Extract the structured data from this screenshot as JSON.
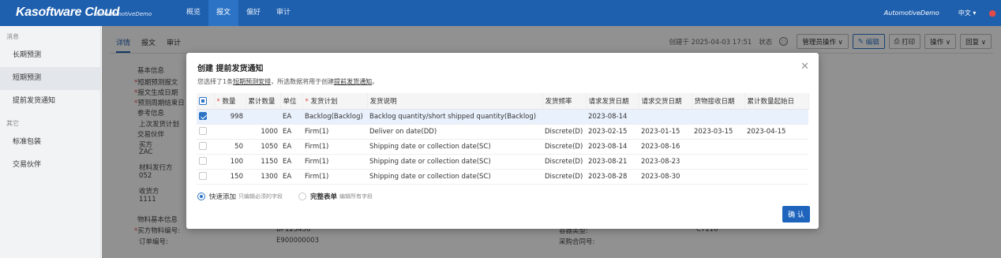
{
  "topbar": {
    "brand": "Kasoftware Cloud",
    "brand_sub": "for AutomotiveDemo",
    "nav": [
      "概览",
      "报文",
      "偏好",
      "审计"
    ],
    "active_nav": 1,
    "tenant": "AutomotiveDemo",
    "language": "中文 ▾"
  },
  "sidebar": {
    "group1": "消息",
    "items1": [
      "长期预测",
      "短期预测",
      "提前发货通知"
    ],
    "active_item": 1,
    "group2": "其它",
    "items2": [
      "标准包装",
      "交易伙伴"
    ]
  },
  "main": {
    "tabs": [
      "详情",
      "报文",
      "审计"
    ],
    "created": "创建于 2025-04-03 17:51",
    "status_label": "状态",
    "buttons": {
      "admin": "管理员操作 ∨",
      "edit": "编辑",
      "print": "打印",
      "ops": "操作 ∨",
      "reply": "回复 ∨"
    }
  },
  "background_form": {
    "basic_info": "基本信息",
    "f1": "短期预测报文",
    "f2": "报文生成日期",
    "f3": "预测周期结束日",
    "ref_info": "参考信息",
    "last_plan": "上次发货计划",
    "partners": "交易伙伴",
    "buyer": "买方",
    "buyer_val": "ZAC",
    "mat_issuer": "材料发行方",
    "mat_issuer_val": "052",
    "receiver": "收货方",
    "receiver_val": "1111",
    "material_info": "物料基本信息",
    "buyer_part_no": "买方物料编号:",
    "buyer_part_val": "BP123456",
    "container_type": "容器类型:",
    "container_val": "CT116",
    "order_no": "订单编号:",
    "order_val": "E900000003",
    "purchase_no": "采购合同号:"
  },
  "dialog": {
    "title": "创建 提前发货通知",
    "desc_pre": "您选择了1条",
    "desc_link1": "短期预测安排",
    "desc_mid": "，所选数据将用于创建",
    "desc_link2": "提前发货通知",
    "desc_post": "。",
    "headers": [
      "数量",
      "累计数量",
      "单位",
      "发货计划",
      "发货说明",
      "发货频率",
      "请求发货日期",
      "请求交货日期",
      "货物接收日期",
      "累计数量起始日"
    ],
    "rows": [
      {
        "qty": "998",
        "cum": "",
        "unit": "EA",
        "plan": "Backlog(Backlog)",
        "note": "Backlog quantity/short shipped quantity(Backlog)",
        "freq": "",
        "req_ship": "2023-08-14",
        "req_deliv": "",
        "recv": "",
        "cum_start": "",
        "checked": true
      },
      {
        "qty": "",
        "cum": "1000",
        "unit": "EA",
        "plan": "Firm(1)",
        "note": "Deliver on date(DD)",
        "freq": "Discrete(D)",
        "req_ship": "2023-02-15",
        "req_deliv": "2023-01-15",
        "recv": "2023-03-15",
        "cum_start": "2023-04-15",
        "checked": false
      },
      {
        "qty": "50",
        "cum": "1050",
        "unit": "EA",
        "plan": "Firm(1)",
        "note": "Shipping date or collection date(SC)",
        "freq": "Discrete(D)",
        "req_ship": "2023-08-14",
        "req_deliv": "2023-08-16",
        "recv": "",
        "cum_start": "",
        "checked": false
      },
      {
        "qty": "100",
        "cum": "1150",
        "unit": "EA",
        "plan": "Firm(1)",
        "note": "Shipping date or collection date(SC)",
        "freq": "Discrete(D)",
        "req_ship": "2023-08-21",
        "req_deliv": "2023-08-23",
        "recv": "",
        "cum_start": "",
        "checked": false
      },
      {
        "qty": "150",
        "cum": "1300",
        "unit": "EA",
        "plan": "Firm(1)",
        "note": "Shipping date or collection date(SC)",
        "freq": "Discrete(D)",
        "req_ship": "2023-08-28",
        "req_deliv": "2023-08-30",
        "recv": "",
        "cum_start": "",
        "checked": false
      }
    ],
    "quick_add": "快速添加",
    "quick_hint": "只编辑必须的字段",
    "full_form": "完整表单",
    "full_hint": "编辑所有字段",
    "confirm": "确 认"
  }
}
